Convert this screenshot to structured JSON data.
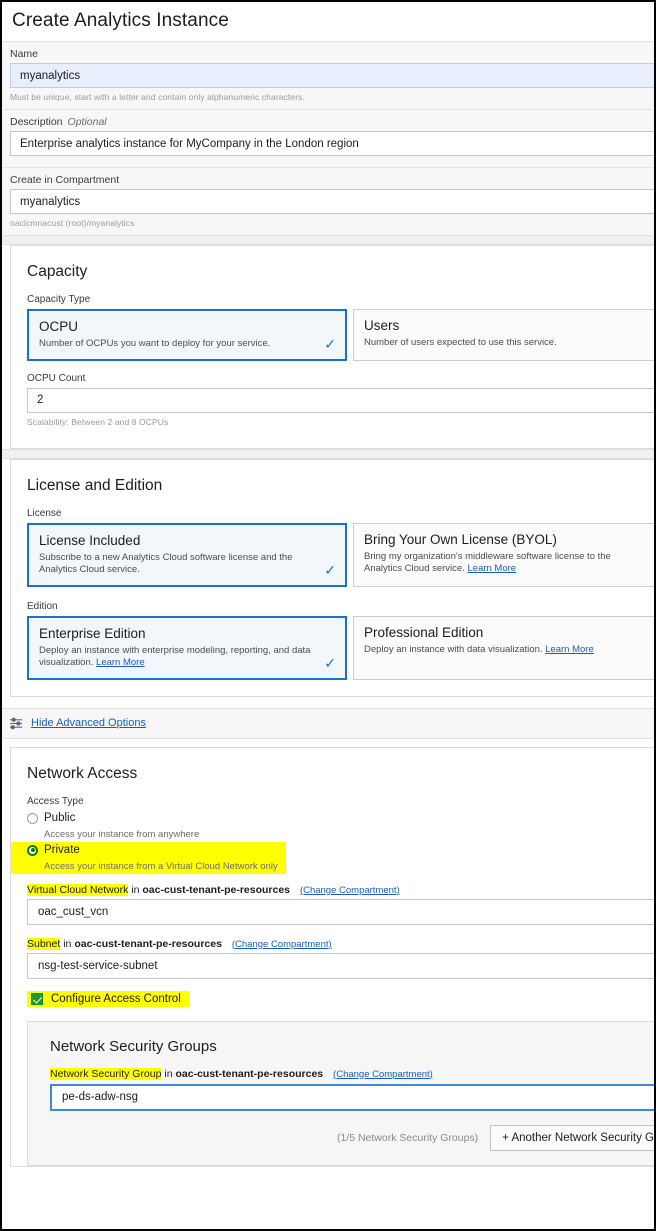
{
  "page": {
    "title": "Create Analytics Instance"
  },
  "form": {
    "name": {
      "label": "Name",
      "value": "myanalytics",
      "helper": "Must be unique, start with a letter and contain only alphanumeric characters."
    },
    "description": {
      "label": "Description",
      "optional": "Optional",
      "value": "Enterprise analytics instance for MyCompany in the London region"
    },
    "compartment": {
      "label": "Create in Compartment",
      "value": "myanalytics",
      "helper": "oaclcmnacust (root)/myanalytics"
    }
  },
  "capacity": {
    "title": "Capacity",
    "type_label": "Capacity Type",
    "options": [
      {
        "title": "OCPU",
        "desc": "Number of OCPUs you want to deploy for your service.",
        "selected": true,
        "check": "✓"
      },
      {
        "title": "Users",
        "desc": "Number of users expected to use this service.",
        "selected": false,
        "check": ""
      }
    ],
    "count_label": "OCPU Count",
    "count_value": "2",
    "count_helper": "Scalability: Between 2 and 8 OCPUs"
  },
  "license": {
    "title": "License and Edition",
    "license_label": "License",
    "license_options": [
      {
        "title": "License Included",
        "desc": "Subscribe to a new Analytics Cloud software license and the Analytics Cloud service.",
        "link": "",
        "selected": true,
        "check": "✓"
      },
      {
        "title": "Bring Your Own License (BYOL)",
        "desc": "Bring my organization's middleware software license to the Analytics Cloud service.",
        "link": "Learn More",
        "selected": false,
        "check": ""
      }
    ],
    "edition_label": "Edition",
    "edition_options": [
      {
        "title": "Enterprise Edition",
        "desc": "Deploy an instance with enterprise modeling, reporting, and data visualization.",
        "link": "Learn More",
        "selected": true,
        "check": "✓"
      },
      {
        "title": "Professional Edition",
        "desc": "Deploy an instance with data visualization.",
        "link": "Learn More",
        "selected": false,
        "check": ""
      }
    ]
  },
  "advanced": {
    "link": "Hide Advanced Options",
    "icon": "sliders-icon"
  },
  "network": {
    "title": "Network Access",
    "access_type_label": "Access Type",
    "access_options": [
      {
        "label": "Public",
        "desc": "Access your instance from anywhere",
        "selected": false,
        "highlighted": false
      },
      {
        "label": "Private",
        "desc": "Access your instance from a Virtual Cloud Network only",
        "selected": true,
        "highlighted": true
      }
    ],
    "vcn": {
      "label": "Virtual Cloud Network",
      "in_word": "in",
      "compartment": "oac-cust-tenant-pe-resources",
      "change_link": "(Change Compartment)",
      "value": "oac_cust_vcn"
    },
    "subnet": {
      "label": "Subnet",
      "in_word": "in",
      "compartment": "oac-cust-tenant-pe-resources",
      "change_link": "(Change Compartment)",
      "value": "nsg-test-service-subnet"
    },
    "access_control": {
      "label": "Configure Access Control",
      "checked": true
    }
  },
  "nsg": {
    "title": "Network Security Groups",
    "label": "Network Security Group",
    "in_word": "in",
    "compartment": "oac-cust-tenant-pe-resources",
    "change_link": "(Change Compartment)",
    "value": "pe-ds-adw-nsg",
    "remove_icon": "×",
    "count_text": "(1/5 Network Security Groups)",
    "add_button": "+ Another Network Security Group"
  },
  "colors": {
    "accent_blue": "#1773c4",
    "link_blue": "#1a5db8",
    "highlight_yellow": "#ffff00",
    "selected_green": "#0a7a0a",
    "check_green": "#1c9c24"
  }
}
